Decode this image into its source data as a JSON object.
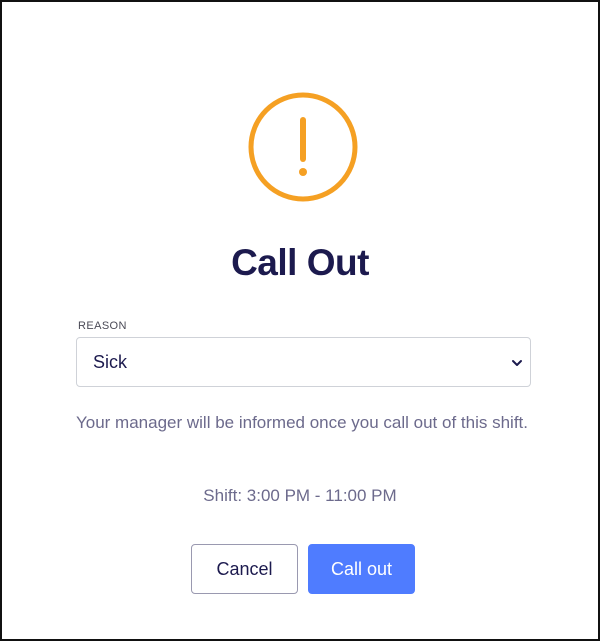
{
  "dialog": {
    "title": "Call Out",
    "icon": "warning-exclamation-icon",
    "accent_color": "#f5a023",
    "reason": {
      "label": "REASON",
      "selected": "Sick"
    },
    "info_text": "Your manager will be informed once you call out of this shift.",
    "shift_text": "Shift: 3:00 PM - 11:00 PM",
    "buttons": {
      "cancel_label": "Cancel",
      "confirm_label": "Call out",
      "confirm_color": "#4f7cff"
    }
  }
}
